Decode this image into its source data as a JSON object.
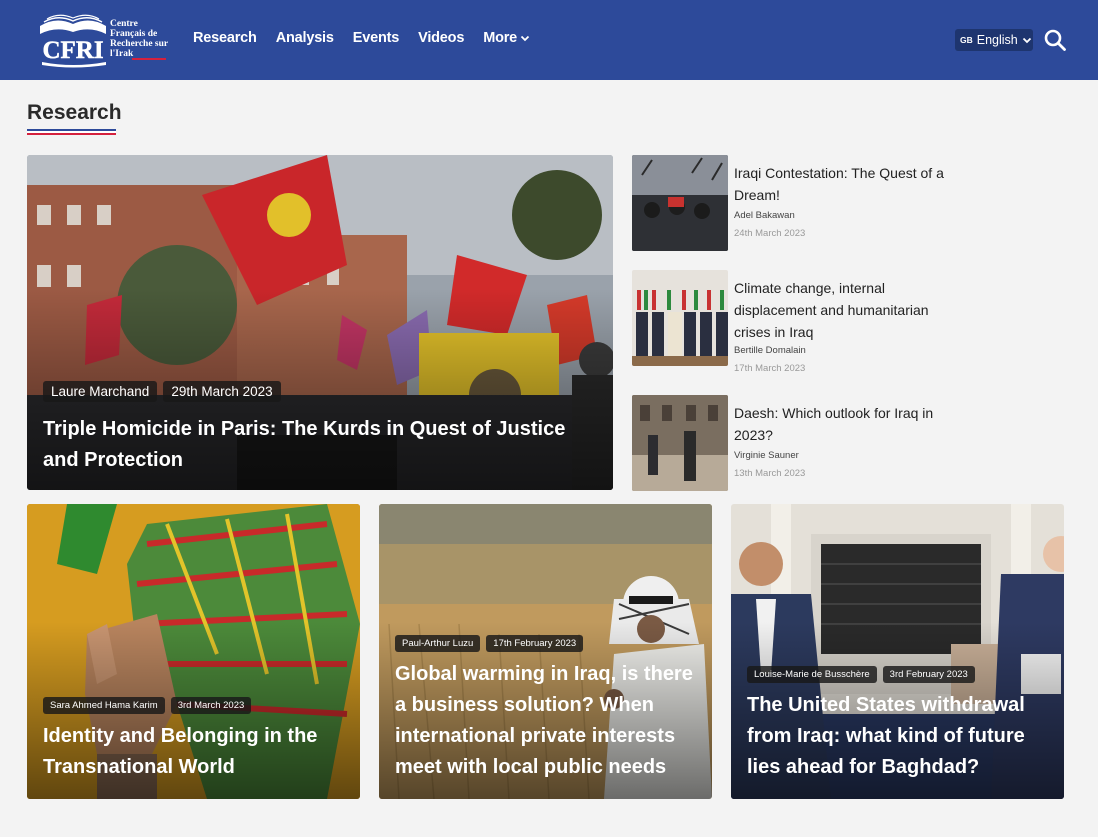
{
  "header": {
    "logo_text": "Centre Français de Recherche sur l'Irak",
    "logo_mark": "CFRI",
    "nav": [
      {
        "label": "Research"
      },
      {
        "label": "Analysis"
      },
      {
        "label": "Events"
      },
      {
        "label": "Videos"
      },
      {
        "label": "More"
      }
    ],
    "language": {
      "flag": "GB",
      "label": "English"
    },
    "icons": {
      "search": "search-icon",
      "more_chevron": "chevron-down-icon",
      "lang_chevron": "chevron-down-icon"
    }
  },
  "section": {
    "title": "Research"
  },
  "featured": {
    "author": "Laure Marchand",
    "date": "29th March 2023",
    "title": "Triple Homicide in Paris: The Kurds in Quest of Justice and Protection"
  },
  "side_articles": [
    {
      "title": "Iraqi Contestation: The Quest of a Dream!",
      "author": "Adel Bakawan",
      "date": "24th March 2023"
    },
    {
      "title": "Climate change, internal displacement and humanitarian crises in Iraq",
      "author": "Bertille Domalain",
      "date": "17th March 2023"
    },
    {
      "title": "Daesh: Which outlook for Iraq in 2023?",
      "author": "Virginie Sauner",
      "date": "13th March 2023"
    }
  ],
  "bottom_articles": [
    {
      "author": "Sara Ahmed Hama Karim",
      "date": "3rd March 2023",
      "title": "Identity and Belonging in the Transnational World"
    },
    {
      "author": "Paul-Arthur Luzu",
      "date": "17th February 2023",
      "title": "Global warming in Iraq, is there a business solution? When international private interests meet with local public needs"
    },
    {
      "author": "Louise-Marie de Busschère",
      "date": "3rd February 2023",
      "title": "The United States withdrawal from Iraq: what kind of future lies ahead for Baghdad?"
    }
  ],
  "colors": {
    "brand_blue": "#2d4a9a",
    "accent_red": "#d4213d",
    "background": "#f3f3f3"
  }
}
